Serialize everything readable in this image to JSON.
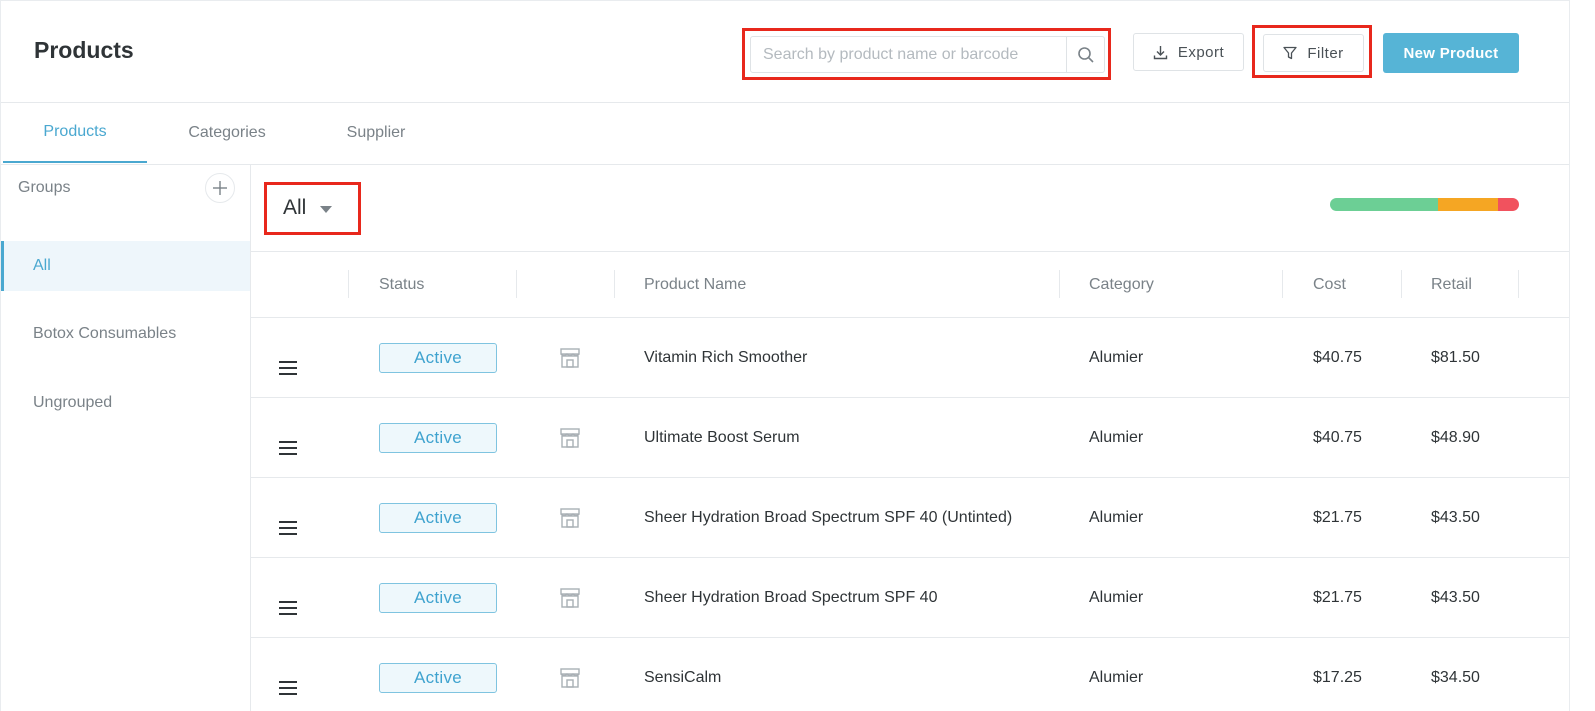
{
  "header": {
    "title": "Products",
    "search_placeholder": "Search by product name or barcode",
    "export_label": "Export",
    "filter_label": "Filter",
    "new_product_label": "New Product"
  },
  "tabs": [
    {
      "label": "Products",
      "active": true
    },
    {
      "label": "Categories",
      "active": false
    },
    {
      "label": "Supplier",
      "active": false
    }
  ],
  "sidebar": {
    "groups_label": "Groups",
    "items": [
      {
        "label": "All",
        "active": true
      },
      {
        "label": "Botox Consumables",
        "active": false
      },
      {
        "label": "Ungrouped",
        "active": false
      }
    ]
  },
  "main": {
    "group_select_value": "All",
    "status_bar_colors": {
      "green": "#6ccf95",
      "orange": "#f5a623",
      "red": "#f1525e"
    },
    "columns": [
      "Status",
      "Product Name",
      "Category",
      "Cost",
      "Retail"
    ],
    "rows": [
      {
        "status": "Active",
        "name": "Vitamin Rich Smoother",
        "category": "Alumier",
        "cost": "$40.75",
        "retail": "$81.50"
      },
      {
        "status": "Active",
        "name": "Ultimate Boost Serum",
        "category": "Alumier",
        "cost": "$40.75",
        "retail": "$48.90"
      },
      {
        "status": "Active",
        "name": "Sheer Hydration Broad Spectrum SPF 40 (Untinted)",
        "category": "Alumier",
        "cost": "$21.75",
        "retail": "$43.50"
      },
      {
        "status": "Active",
        "name": "Sheer Hydration Broad Spectrum SPF 40",
        "category": "Alumier",
        "cost": "$21.75",
        "retail": "$43.50"
      },
      {
        "status": "Active",
        "name": "SensiCalm",
        "category": "Alumier",
        "cost": "$17.25",
        "retail": "$34.50"
      }
    ]
  },
  "colors": {
    "accent": "#56b4d6",
    "highlight": "#e8281c"
  }
}
